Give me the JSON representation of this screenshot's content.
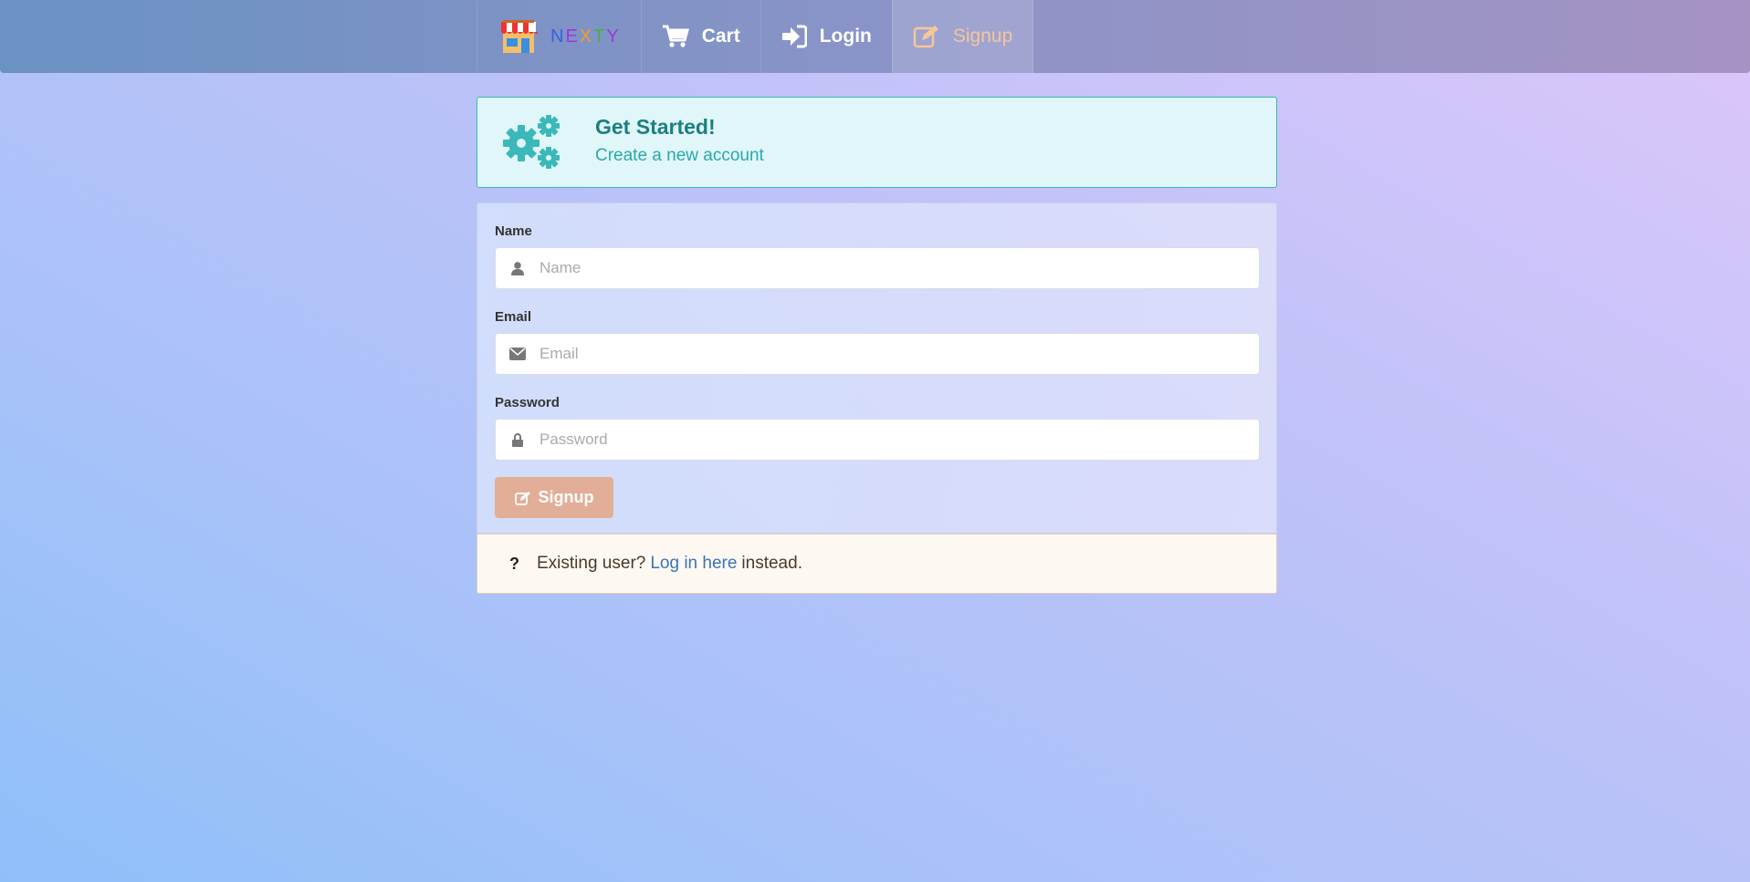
{
  "nav": {
    "brand": {
      "letters": [
        "N",
        "E",
        "X",
        "T",
        "Y"
      ],
      "letter_colors": [
        "#2b5fe0",
        "#7a3ad8",
        "#f0a020",
        "#44b04a",
        "#7a3ad8"
      ],
      "icon": "store-icon"
    },
    "items": [
      {
        "label": "Cart",
        "icon": "cart-icon",
        "active": false
      },
      {
        "label": "Login",
        "icon": "sign-in-icon",
        "active": false
      },
      {
        "label": "Signup",
        "icon": "edit-icon",
        "active": true
      }
    ]
  },
  "header": {
    "title": "Get Started!",
    "subtitle": "Create a new account",
    "icon": "gears-icon"
  },
  "form": {
    "fields": [
      {
        "label": "Name",
        "placeholder": "Name",
        "icon": "user-icon"
      },
      {
        "label": "Email",
        "placeholder": "Email",
        "icon": "envelope-icon"
      },
      {
        "label": "Password",
        "placeholder": "Password",
        "icon": "lock-icon"
      }
    ],
    "submit_label": "Signup"
  },
  "existing": {
    "prefix": "Existing user?",
    "link": "Log in here",
    "suffix": "instead."
  },
  "colors": {
    "accent_teal": "#1b7f82",
    "button": "#e2ae98",
    "link": "#3a73b8",
    "active_nav": "#f6c69a"
  }
}
